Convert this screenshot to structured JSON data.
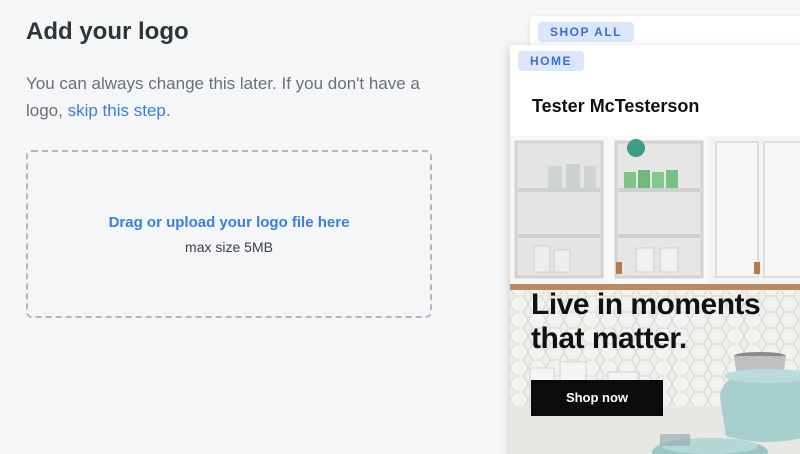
{
  "page": {
    "title": "Add your logo",
    "description": "You can always change this later. If you don't have a logo, ",
    "skip_link": "skip this step."
  },
  "upload": {
    "prompt": "Drag or upload your logo file here",
    "limit": "max size 5MB"
  },
  "preview": {
    "back_tab": "SHOP ALL",
    "front_tab": "HOME",
    "store_name": "Tester McTesterson",
    "hero_headline": "Live in moments that matter.",
    "hero_button": "Shop now",
    "colors": {
      "accent": "#3b7de0",
      "pill_bg": "#dbe6fb",
      "button_bg": "#0b0b0b"
    }
  }
}
